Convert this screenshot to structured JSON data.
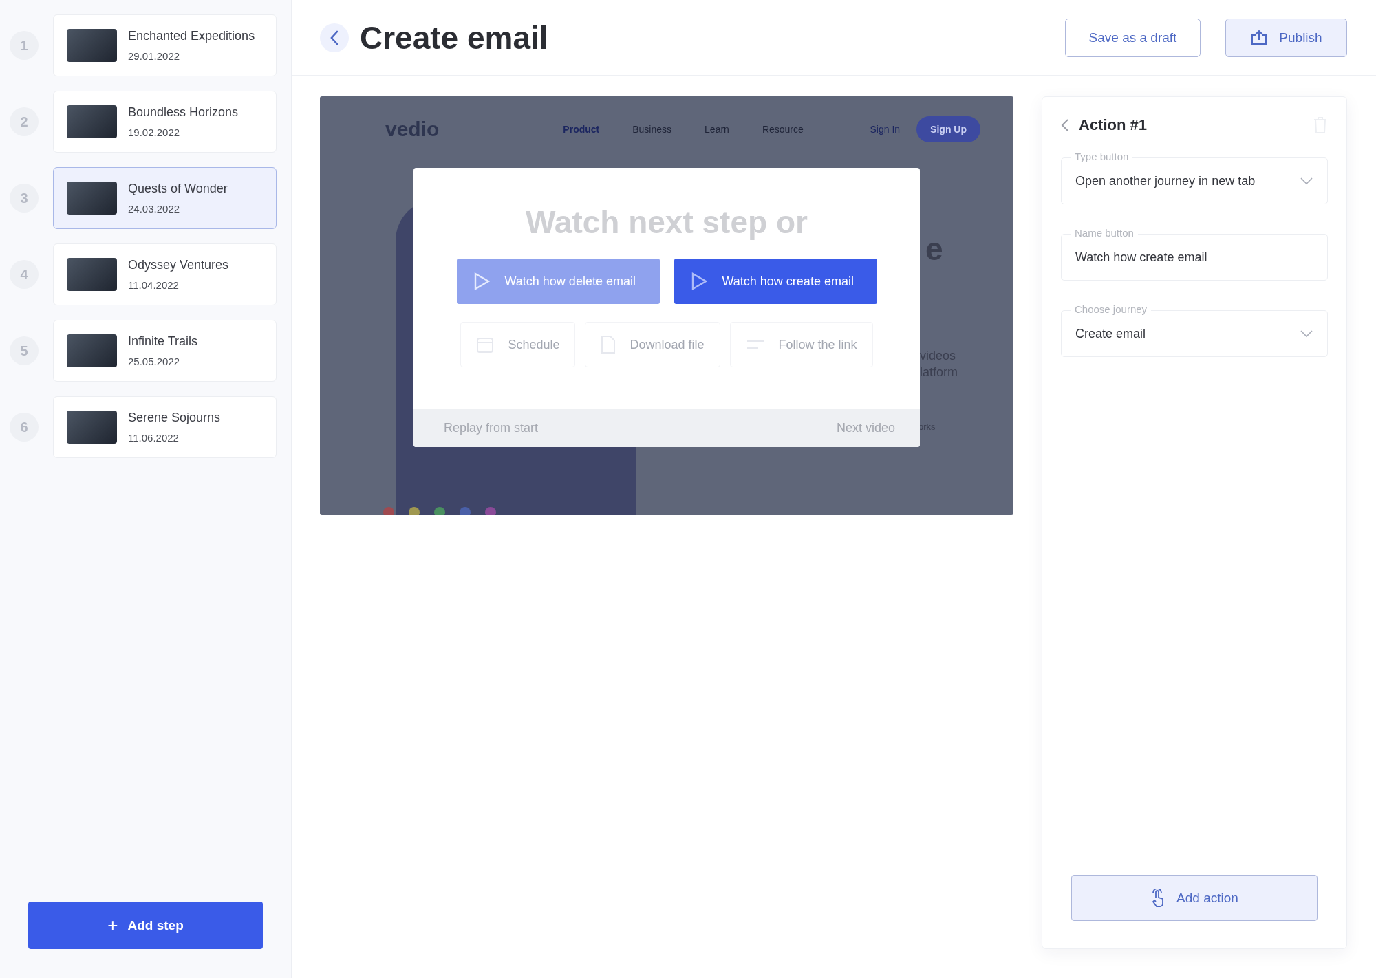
{
  "sidebar": {
    "steps": [
      {
        "number": "1",
        "title": "Enchanted Expeditions",
        "date": "29.01.2022",
        "selected": false
      },
      {
        "number": "2",
        "title": "Boundless Horizons",
        "date": "19.02.2022",
        "selected": false
      },
      {
        "number": "3",
        "title": "Quests of Wonder",
        "date": "24.03.2022",
        "selected": true
      },
      {
        "number": "4",
        "title": "Odyssey Ventures",
        "date": "11.04.2022",
        "selected": false
      },
      {
        "number": "5",
        "title": "Infinite Trails",
        "date": "25.05.2022",
        "selected": false
      },
      {
        "number": "6",
        "title": "Serene Sojourns",
        "date": "11.06.2022",
        "selected": false
      }
    ],
    "add_button": {
      "icon": "+",
      "label": "Add step"
    }
  },
  "header": {
    "title": "Create email",
    "buttons": [
      {
        "kind": "outline",
        "label": "Save as a draft"
      },
      {
        "kind": "publish",
        "label": "Publish"
      }
    ]
  },
  "preview": {
    "site": {
      "logo": "vedio",
      "nav": [
        {
          "label": "Product",
          "selected": true
        },
        {
          "label": "Business",
          "selected": false
        },
        {
          "label": "Learn",
          "selected": false
        },
        {
          "label": "Resource",
          "selected": false
        }
      ],
      "sign_in": "Sign In",
      "sign_up": "Sign Up",
      "fragments": [
        "e",
        "videos",
        "latform",
        "orks"
      ]
    },
    "modal": {
      "title": "Watch next step or",
      "buttons": [
        {
          "label": "Watch how delete email",
          "selected": false
        },
        {
          "label": "Watch how create email",
          "selected": true
        }
      ],
      "options": [
        {
          "kind": "schedule",
          "label": "Schedule"
        },
        {
          "kind": "download",
          "label": "Download file"
        },
        {
          "kind": "link",
          "label": "Follow the link"
        }
      ],
      "footer": {
        "left": "Replay from start",
        "right": "Next video"
      }
    }
  },
  "action_panel": {
    "title": "Action #1",
    "fields": [
      {
        "kind": "select",
        "label": "Type button",
        "value": "Open another journey in new tab"
      },
      {
        "kind": "text",
        "label": "Name button",
        "value": "Watch how create email"
      },
      {
        "kind": "select",
        "label": "Choose journey",
        "value": "Create email"
      }
    ],
    "add_button": "Add action"
  }
}
